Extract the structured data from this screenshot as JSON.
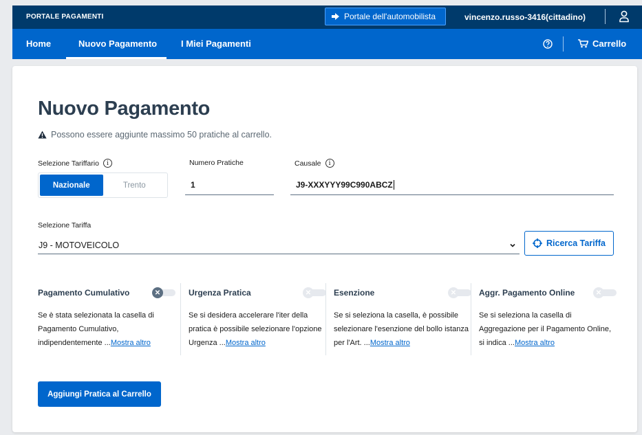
{
  "topbar": {
    "brand": "PORTALE PAGAMENTI",
    "portal_link": "Portale dell'automobilista",
    "user": "vincenzo.russo-3416(cittadino)"
  },
  "nav": {
    "tabs": [
      {
        "label": "Home"
      },
      {
        "label": "Nuovo Pagamento"
      },
      {
        "label": "I Miei Pagamenti"
      }
    ],
    "active_tab": "Nuovo Pagamento",
    "cart_label": "Carrello"
  },
  "page": {
    "title": "Nuovo Pagamento",
    "warning": "Possono essere aggiunte massimo 50 pratiche al carrello."
  },
  "form": {
    "tariffario_label": "Selezione Tariffario",
    "tariffario_options": [
      "Nazionale",
      "Trento"
    ],
    "tariffario_selected": "Nazionale",
    "numero_pratiche_label": "Numero Pratiche",
    "numero_pratiche_value": "1",
    "causale_label": "Causale",
    "causale_value": "J9-XXXYYY99C990ABCZ",
    "tariffa_label": "Selezione Tariffa",
    "tariffa_value": "J9 - MOTOVEICOLO",
    "ricerca_button": "Ricerca Tariffa"
  },
  "options": [
    {
      "label": "Pagamento Cumulativo",
      "text": "Se è stata selezionata la casella di Pagamento Cumulativo, indipendentemente ...",
      "more": "Mostra altro",
      "checked": false
    },
    {
      "label": "Urgenza Pratica",
      "text": "Se si desidera accelerare l'iter della pratica è possibile selezionare l'opzione Urgenza ...",
      "more": "Mostra altro",
      "checked": false
    },
    {
      "label": "Esenzione",
      "text": "Se si seleziona la casella, è possibile selezionare l'esenzione del bollo istanza per l'Art. ...",
      "more": "Mostra altro",
      "checked": false
    },
    {
      "label": "Aggr. Pagamento Online",
      "text": "Se si seleziona la casella di Aggregazione per il Pagamento Online, si indica ...",
      "more": "Mostra altro",
      "checked": false
    }
  ],
  "actions": {
    "add_button": "Aggiungi Pratica al Carrello"
  },
  "colors": {
    "topbar": "#003a6b",
    "primary": "#0066cc",
    "title": "#2c3e50"
  }
}
